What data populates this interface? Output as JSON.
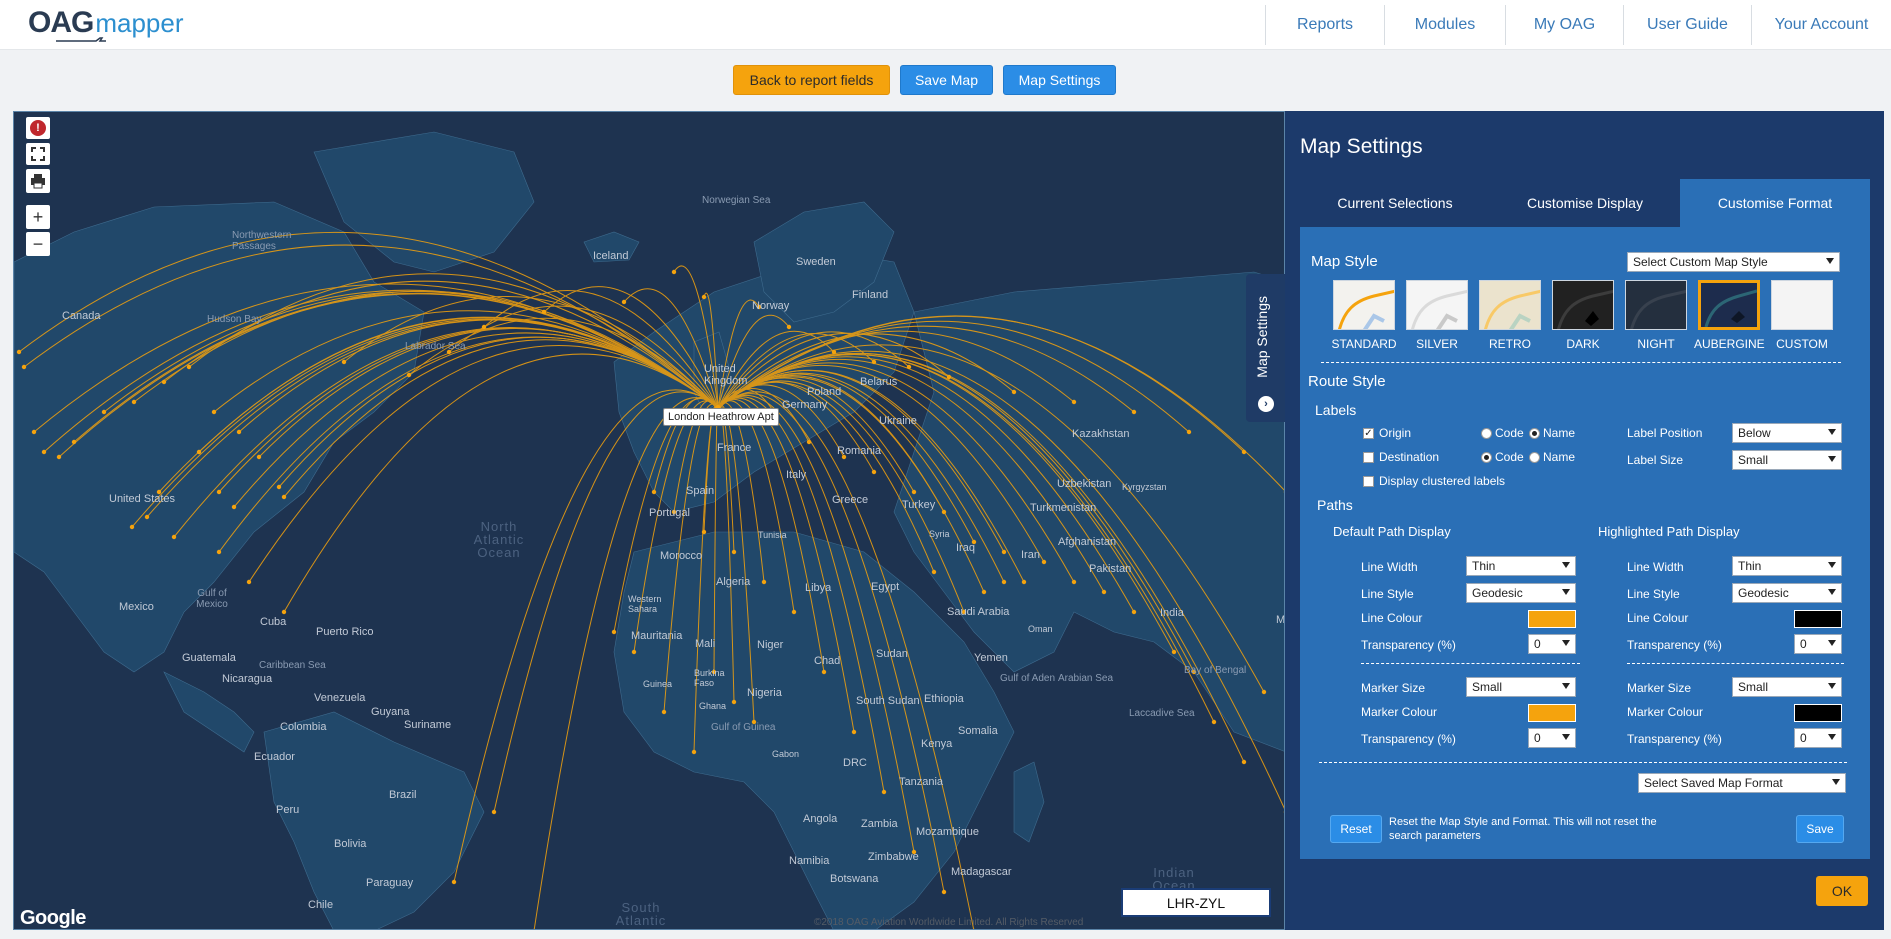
{
  "brand": {
    "logo_primary": "OAG",
    "logo_secondary": "mapper"
  },
  "nav": {
    "items": [
      "Reports",
      "Modules",
      "My OAG",
      "User Guide",
      "Your Account"
    ]
  },
  "toolbar": {
    "back_label": "Back to report fields",
    "save_map_label": "Save Map",
    "map_settings_label": "Map Settings"
  },
  "map": {
    "origin_label": "London Heathrow Apt",
    "route_box": "LHR-ZYL",
    "google": "Google",
    "copyright": "©2018 OAG Aviation Worldwide Limited. All Rights Reserved",
    "side_tab": "Map Settings",
    "controls": {
      "zoom_in": "+",
      "zoom_out": "−"
    },
    "countries": [
      "Canada",
      "United States",
      "Mexico",
      "Cuba",
      "Puerto Rico",
      "Guatemala",
      "Nicaragua",
      "Venezuela",
      "Guyana",
      "Suriname",
      "Colombia",
      "Ecuador",
      "Peru",
      "Brazil",
      "Bolivia",
      "Paraguay",
      "Chile",
      "Iceland",
      "Norway",
      "Sweden",
      "Finland",
      "United Kingdom",
      "Poland",
      "Belarus",
      "Ukraine",
      "Germany",
      "France",
      "Spain",
      "Portugal",
      "Italy",
      "Greece",
      "Turkey",
      "Romania",
      "Morocco",
      "Algeria",
      "Tunisia",
      "Libya",
      "Egypt",
      "Mauritania",
      "Mali",
      "Niger",
      "Chad",
      "Sudan",
      "Nigeria",
      "Ghana",
      "Guinea",
      "Burkina Faso",
      "Ethiopia",
      "South Sudan",
      "Somalia",
      "Kenya",
      "Tanzania",
      "DRC",
      "Angola",
      "Zambia",
      "Mozambique",
      "Zimbabwe",
      "Namibia",
      "Botswana",
      "Madagascar",
      "Saudi Arabia",
      "Oman",
      "Yemen",
      "Iraq",
      "Syria",
      "Iran",
      "Afghanistan",
      "Pakistan",
      "India",
      "Turkmenistan",
      "Uzbekistan",
      "Kyrgyzstan",
      "Kazakhstan",
      "Myanmar (Burma)",
      "Gabon",
      "Western Sahara"
    ],
    "waters": [
      "Norwegian Sea",
      "Hudson Bay",
      "Labrador Sea",
      "Northwestern Passages",
      "North Atlantic Ocean",
      "Gulf of Mexico",
      "Caribbean Sea",
      "Gulf of Guinea",
      "Gulf of Aden",
      "Arabian Sea",
      "Bay of Bengal",
      "Laccadive Sea",
      "South Atlantic Ocean",
      "Indian Ocean"
    ]
  },
  "panel": {
    "title": "Map Settings",
    "tabs": [
      "Current Selections",
      "Customise Display",
      "Customise Format"
    ],
    "active_tab": "Customise Format",
    "map_style": {
      "heading": "Map Style",
      "custom_select": "Select Custom Map Style",
      "styles": [
        "STANDARD",
        "SILVER",
        "RETRO",
        "DARK",
        "NIGHT",
        "AUBERGINE",
        "CUSTOM"
      ],
      "selected": "AUBERGINE"
    },
    "route_style": "Route Style",
    "labels": {
      "heading": "Labels",
      "origin": "Origin",
      "destination": "Destination",
      "clustered": "Display clustered labels",
      "code": "Code",
      "name": "Name",
      "label_position": "Label Position",
      "label_position_value": "Below",
      "label_size": "Label Size",
      "label_size_value": "Small"
    },
    "paths": {
      "heading": "Paths",
      "default_heading": "Default Path Display",
      "highlighted_heading": "Highlighted Path Display",
      "line_width": "Line Width",
      "line_style": "Line Style",
      "line_colour": "Line Colour",
      "transparency": "Transparency (%)",
      "marker_size": "Marker Size",
      "marker_colour": "Marker Colour",
      "default": {
        "line_width": "Thin",
        "line_style": "Geodesic",
        "line_colour": "#f5a30d",
        "transparency": "0",
        "marker_size": "Small",
        "marker_colour": "#f5a30d",
        "marker_transparency": "0"
      },
      "highlighted": {
        "line_width": "Thin",
        "line_style": "Geodesic",
        "line_colour": "#000000",
        "transparency": "0",
        "marker_size": "Small",
        "marker_colour": "#000000",
        "marker_transparency": "0"
      }
    },
    "saved_format": "Select Saved Map Format",
    "reset_label": "Reset",
    "reset_note": "Reset the Map Style and Format. This will not reset the search parameters",
    "save_label": "Save",
    "ok_label": "OK"
  },
  "colors": {
    "accent": "#f5a30d",
    "primary": "#2b8de6",
    "panel": "#1c3a6b",
    "route": "#f5a30d"
  }
}
